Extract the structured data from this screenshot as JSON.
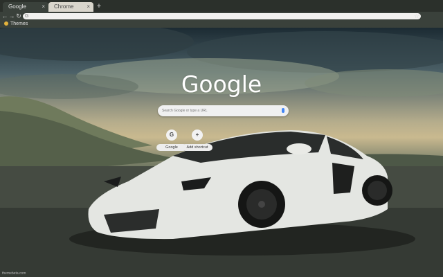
{
  "tabs": [
    {
      "label": "Google",
      "close": "×"
    },
    {
      "label": "Chrome",
      "close": "×"
    }
  ],
  "newtab_label": "+",
  "toolbar": {
    "back": "←",
    "forward": "→",
    "reload": "↻",
    "omnibox_icon": "G",
    "star": "☆"
  },
  "bookmarks": [
    {
      "label": "Themes",
      "icon": "themes-icon"
    }
  ],
  "ntp": {
    "logo": "Google",
    "search_placeholder": "Search Google or type a URL",
    "shortcuts": [
      {
        "icon_text": "G",
        "label": "Google"
      },
      {
        "icon_text": "+",
        "label": "Add shortcut"
      }
    ],
    "credit": "themebeta.com"
  },
  "colors": {
    "tabstrip": "#2b302b",
    "toolbar": "#3a413b",
    "car_body": "#e4e6e2",
    "mic": "#4285f4"
  }
}
